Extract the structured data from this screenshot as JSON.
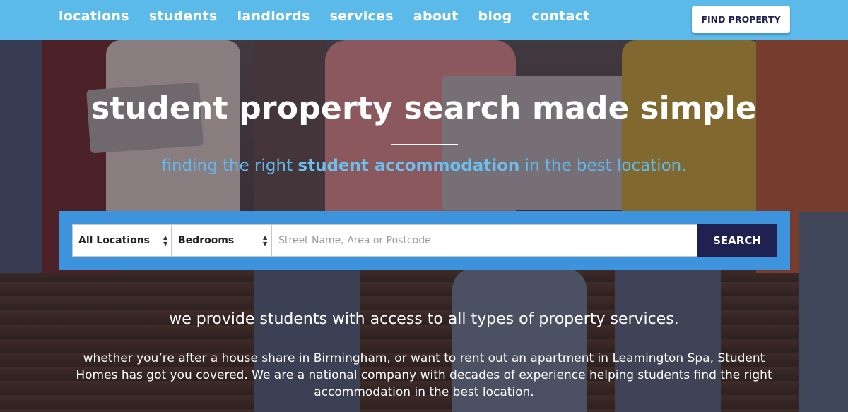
{
  "nav": {
    "links": [
      "locations",
      "students",
      "landlords",
      "services",
      "about",
      "blog",
      "contact"
    ],
    "cta_label": "FIND PROPERTY"
  },
  "hero": {
    "title": "student property search made simple",
    "subtitle_pre": "finding the right ",
    "subtitle_emph": "student accommodation",
    "subtitle_post": " in the best location."
  },
  "search": {
    "location_value": "All Locations",
    "bedrooms_value": "Bedrooms",
    "query_placeholder": "Street Name, Area or Postcode",
    "button_label": "SEARCH"
  },
  "intro": {
    "heading": "we provide students with access to all types of property services.",
    "body": "whether you’re after a house share in Birmingham, or want to rent out an apartment in Leamington Spa, Student Homes has got you covered. We are a national company with decades of experience helping students find the right accommodation in the best location."
  },
  "colors": {
    "nav_bg": "#5cbaeb",
    "accent_blue": "#3d94dc",
    "navy": "#1f2150"
  }
}
